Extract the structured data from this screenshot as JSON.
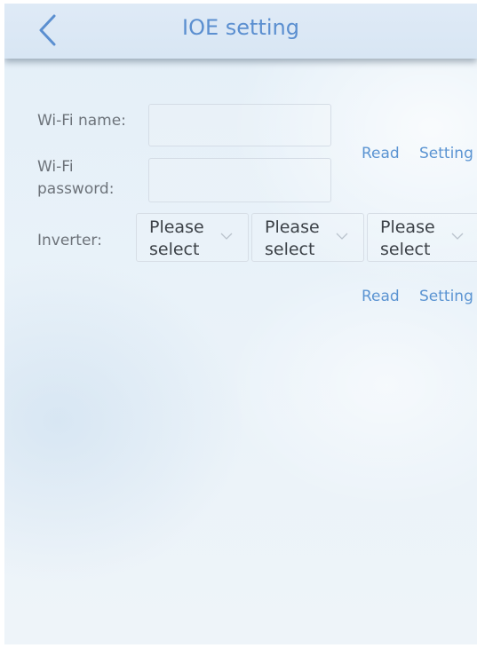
{
  "header": {
    "title": "IOE setting",
    "back_icon": "chevron-left-icon"
  },
  "form": {
    "wifi_name": {
      "label": "Wi-Fi name:",
      "value": ""
    },
    "wifi_password": {
      "label_line1": "Wi-Fi",
      "label_line2": "password:",
      "value": ""
    },
    "wifi_actions": {
      "read": "Read",
      "setting": "Setting"
    },
    "inverter": {
      "label": "Inverter:",
      "selects": [
        {
          "line1": "Please",
          "line2": "select"
        },
        {
          "line1": "Please",
          "line2": "select"
        },
        {
          "line1": "Please",
          "line2": "select"
        }
      ],
      "dropdown_icon": "chevron-down-icon"
    },
    "inverter_actions": {
      "read": "Read",
      "setting": "Setting"
    }
  },
  "colors": {
    "accent": "#5b8fd0",
    "link": "#5b94d2",
    "label": "#6d737a",
    "background": "#e6f0f8"
  }
}
